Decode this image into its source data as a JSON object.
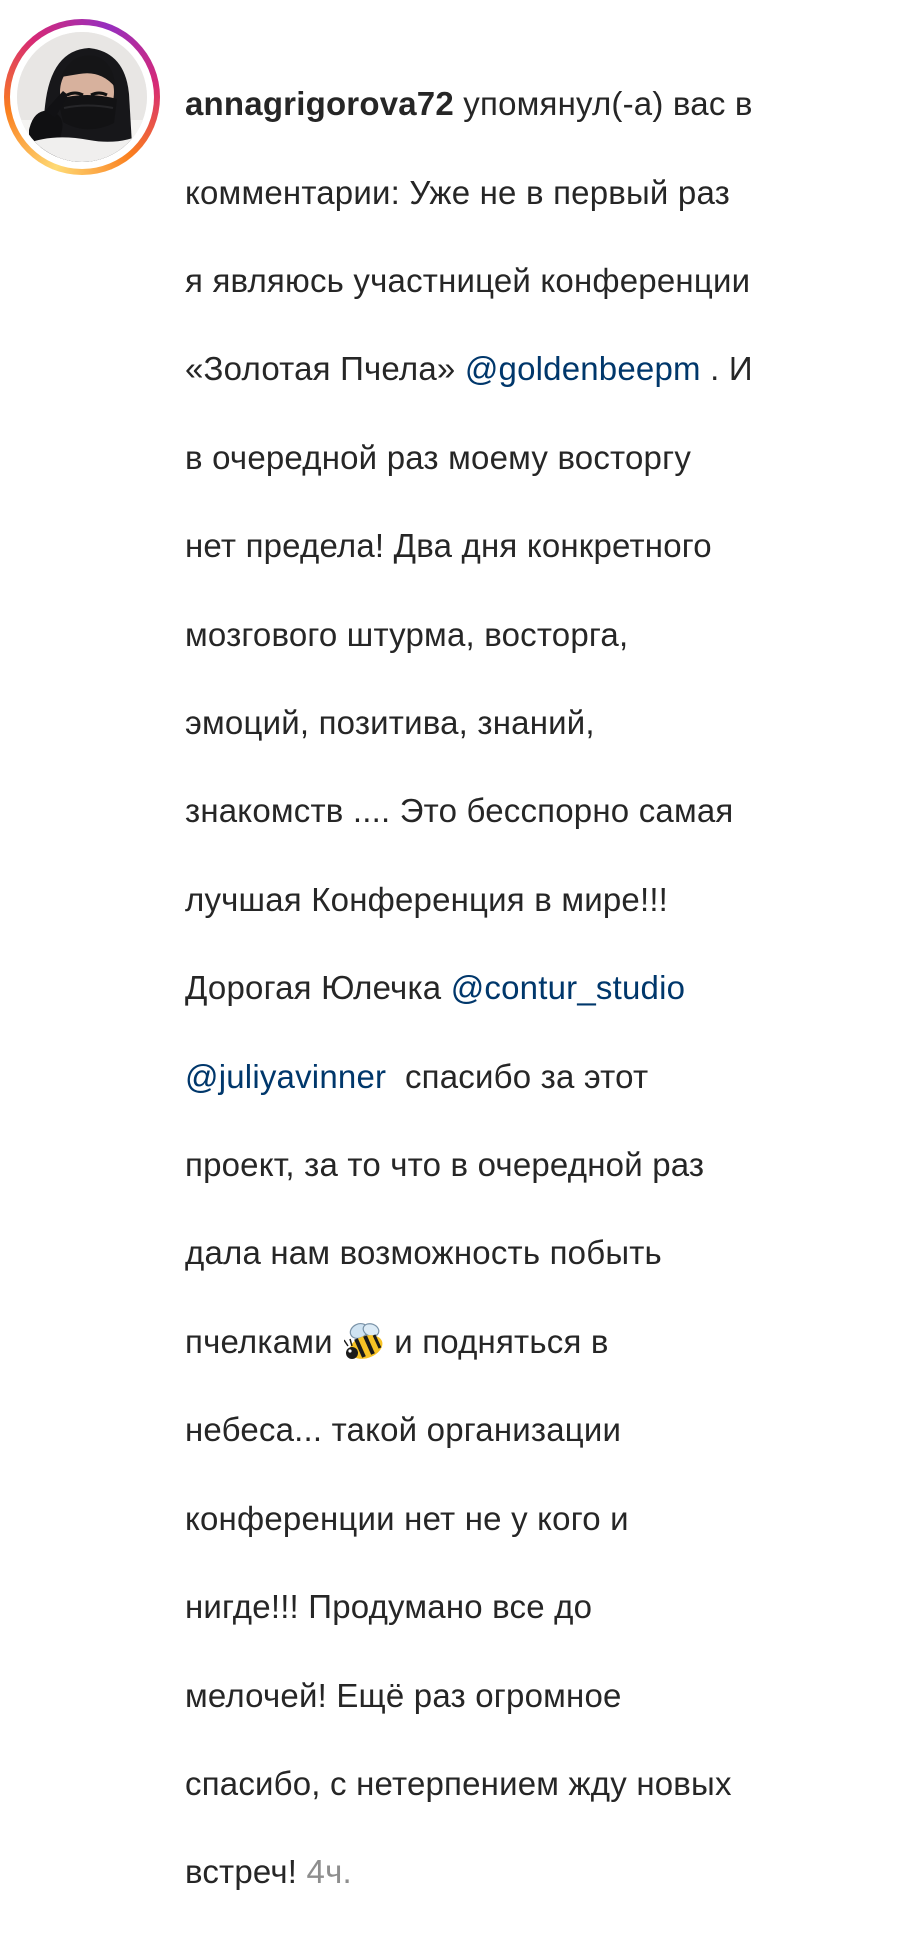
{
  "notification": {
    "username": "annagrigorova72",
    "action": "упомянул(-а) вас в",
    "avatar": {
      "icon": "profile-photo"
    },
    "lines": [
      "комментарии: Уже не в первый раз",
      "я являюсь участницей конференции",
      "«Золотая Пчела»",
      "@goldenbeepm",
      ". И",
      "в очередной раз моему восторгу",
      "нет предела! Два дня конкретного",
      "мозгового штурма, восторга,",
      "эмоций, позитива, знаний,",
      "знакомств .... Это бесспорно самая",
      "лучшая Конференция в мире!!!",
      "Дорогая Юлечка",
      "@contur_studio",
      "@juliyavinner",
      "спасибо за этот",
      "проект, за то что в очередной раз",
      "дала нам возможность побыть",
      "пчелками",
      "и подняться в",
      "небеса... такой организации",
      "конференции нет не у кого и",
      "нигде!!! Продумано все до",
      "мелочей! Ещё раз огромное",
      "спасибо, с нетерпением жду новых",
      "встреч!"
    ],
    "emoji": "bee-icon",
    "timestamp": "4ч."
  },
  "colors": {
    "text": "#262626",
    "mention": "#00376b",
    "timestamp": "#8e8e8e",
    "story_ring_start": "#feda75",
    "story_ring_end": "#d62976"
  }
}
